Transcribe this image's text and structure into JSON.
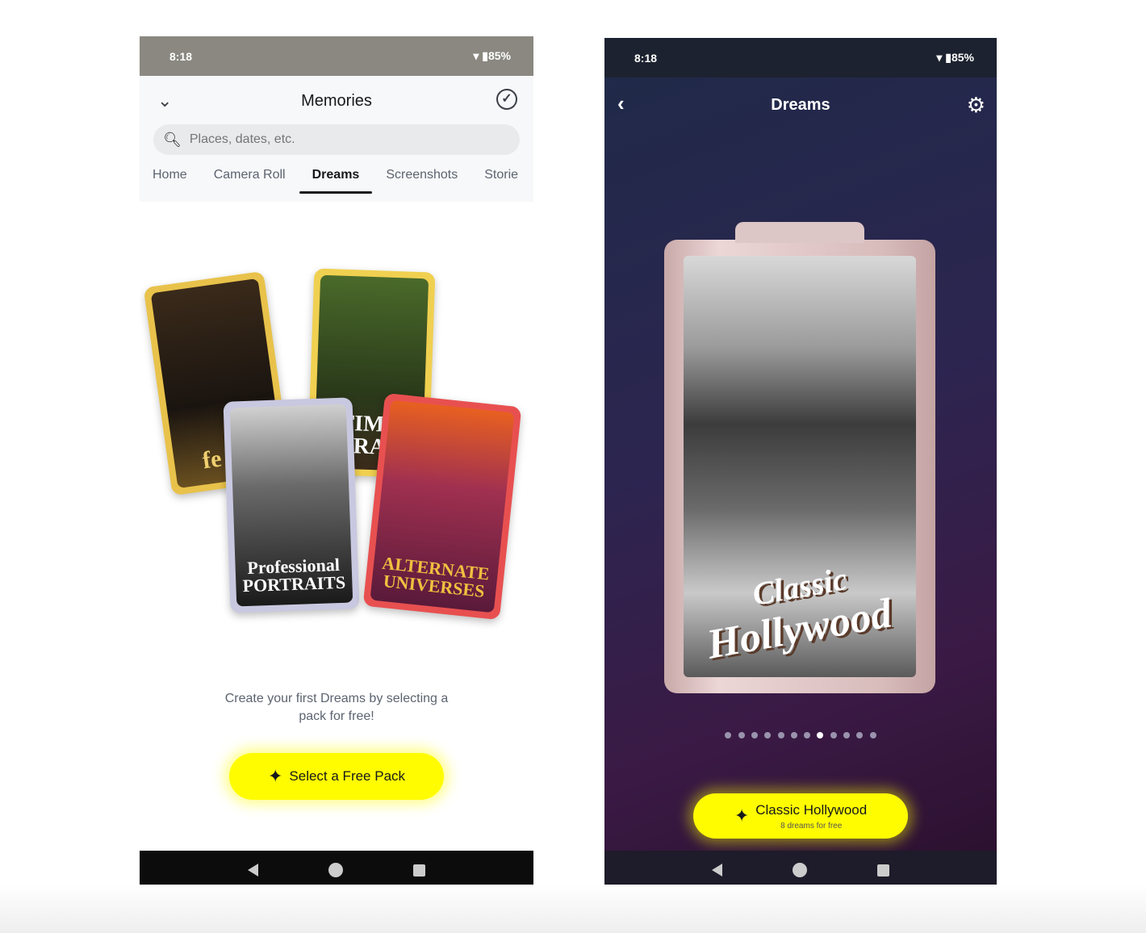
{
  "left": {
    "status": {
      "time": "8:18",
      "battery": "85%",
      "icons": [
        "wifi-icon",
        "signal-icon",
        "battery-icon"
      ]
    },
    "header": {
      "title": "Memories",
      "back_icon": "chevron-down-icon",
      "select_icon": "check-circle-icon"
    },
    "search": {
      "placeholder": "Places, dates, etc.",
      "value": ""
    },
    "tabs": [
      {
        "label": "Home"
      },
      {
        "label": "Camera Roll"
      },
      {
        "label": "Dreams",
        "active": true
      },
      {
        "label": "Screenshots"
      },
      {
        "label": "Storie"
      }
    ],
    "cards": [
      {
        "title": "fe Fa"
      },
      {
        "title": "TIME TRAV"
      },
      {
        "title": "Professional PORTRAITS"
      },
      {
        "title": "ALTERNATE UNIVERSES"
      }
    ],
    "cta_text": "Create your first Dreams by selecting a pack for free!",
    "cta_button": "Select a Free Pack",
    "accent": "#fffc00"
  },
  "right": {
    "status": {
      "time": "8:18",
      "battery": "85%"
    },
    "header": {
      "title": "Dreams",
      "back_icon": "chevron-left-icon",
      "settings_icon": "gear-icon"
    },
    "preview": {
      "line1": "Classic",
      "line2": "Hollywood"
    },
    "pager": {
      "count": 12,
      "active_index": 7
    },
    "button": {
      "title": "Classic Hollywood",
      "subtitle": "8 dreams for free"
    }
  }
}
